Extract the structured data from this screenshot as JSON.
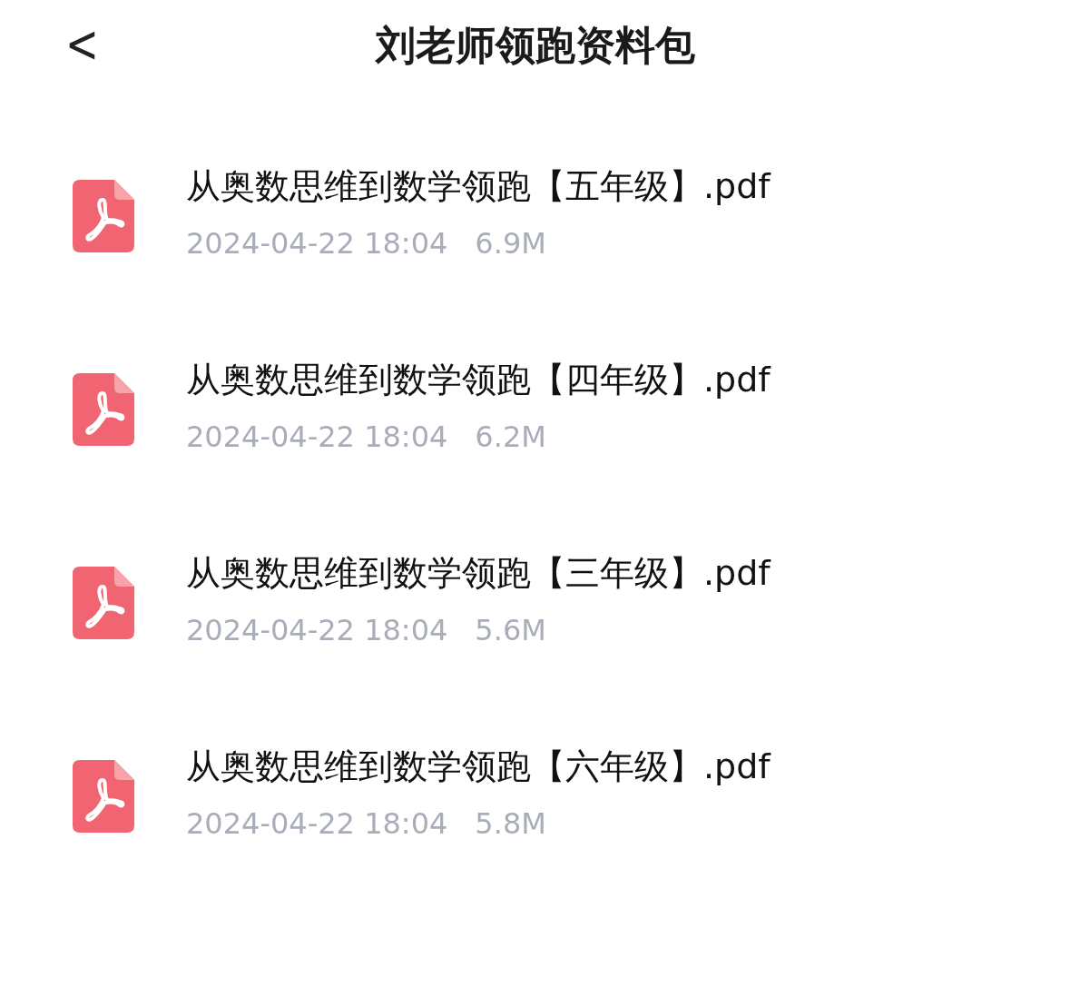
{
  "header": {
    "back": "<",
    "title": "刘老师领跑资料包"
  },
  "files": [
    {
      "name": "从奥数思维到数学领跑【五年级】.pdf",
      "date": "2024-04-22 18:04",
      "size": "6.9M"
    },
    {
      "name": "从奥数思维到数学领跑【四年级】.pdf",
      "date": "2024-04-22 18:04",
      "size": "6.2M"
    },
    {
      "name": "从奥数思维到数学领跑【三年级】.pdf",
      "date": "2024-04-22 18:04",
      "size": "5.6M"
    },
    {
      "name": "从奥数思维到数学领跑【六年级】.pdf",
      "date": "2024-04-22 18:04",
      "size": "5.8M"
    }
  ]
}
